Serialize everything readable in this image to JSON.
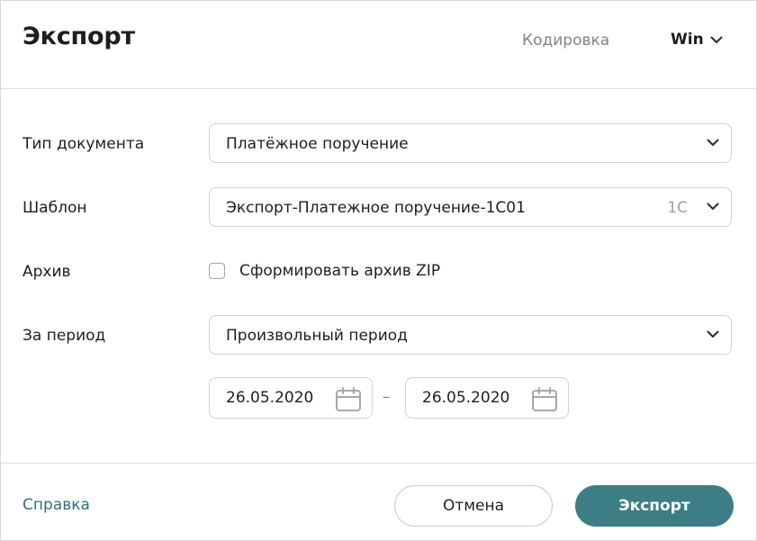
{
  "header": {
    "title": "Экспорт",
    "encoding_label": "Кодировка",
    "encoding_value": "Win"
  },
  "form": {
    "doc_type": {
      "label": "Тип документа",
      "value": "Платёжное поручение"
    },
    "template": {
      "label": "Шаблон",
      "value": "Экспорт-Платежное поручение-1С01",
      "suffix": "1С"
    },
    "archive": {
      "label": "Архив",
      "checkbox_label": "Сформировать архив ZIP",
      "checked": false
    },
    "period": {
      "label": "За период",
      "value": "Произвольный период"
    },
    "dates": {
      "from": "26.05.2020",
      "separator": "–",
      "to": "26.05.2020"
    }
  },
  "footer": {
    "help": "Справка",
    "cancel": "Отмена",
    "export": "Экспорт"
  },
  "colors": {
    "accent": "#3d7d85",
    "link": "#2f6f7a",
    "muted": "#7f848b",
    "border": "#cfd2d6"
  },
  "icons": {
    "chevron": "chevron-down-icon",
    "calendar": "calendar-icon"
  }
}
